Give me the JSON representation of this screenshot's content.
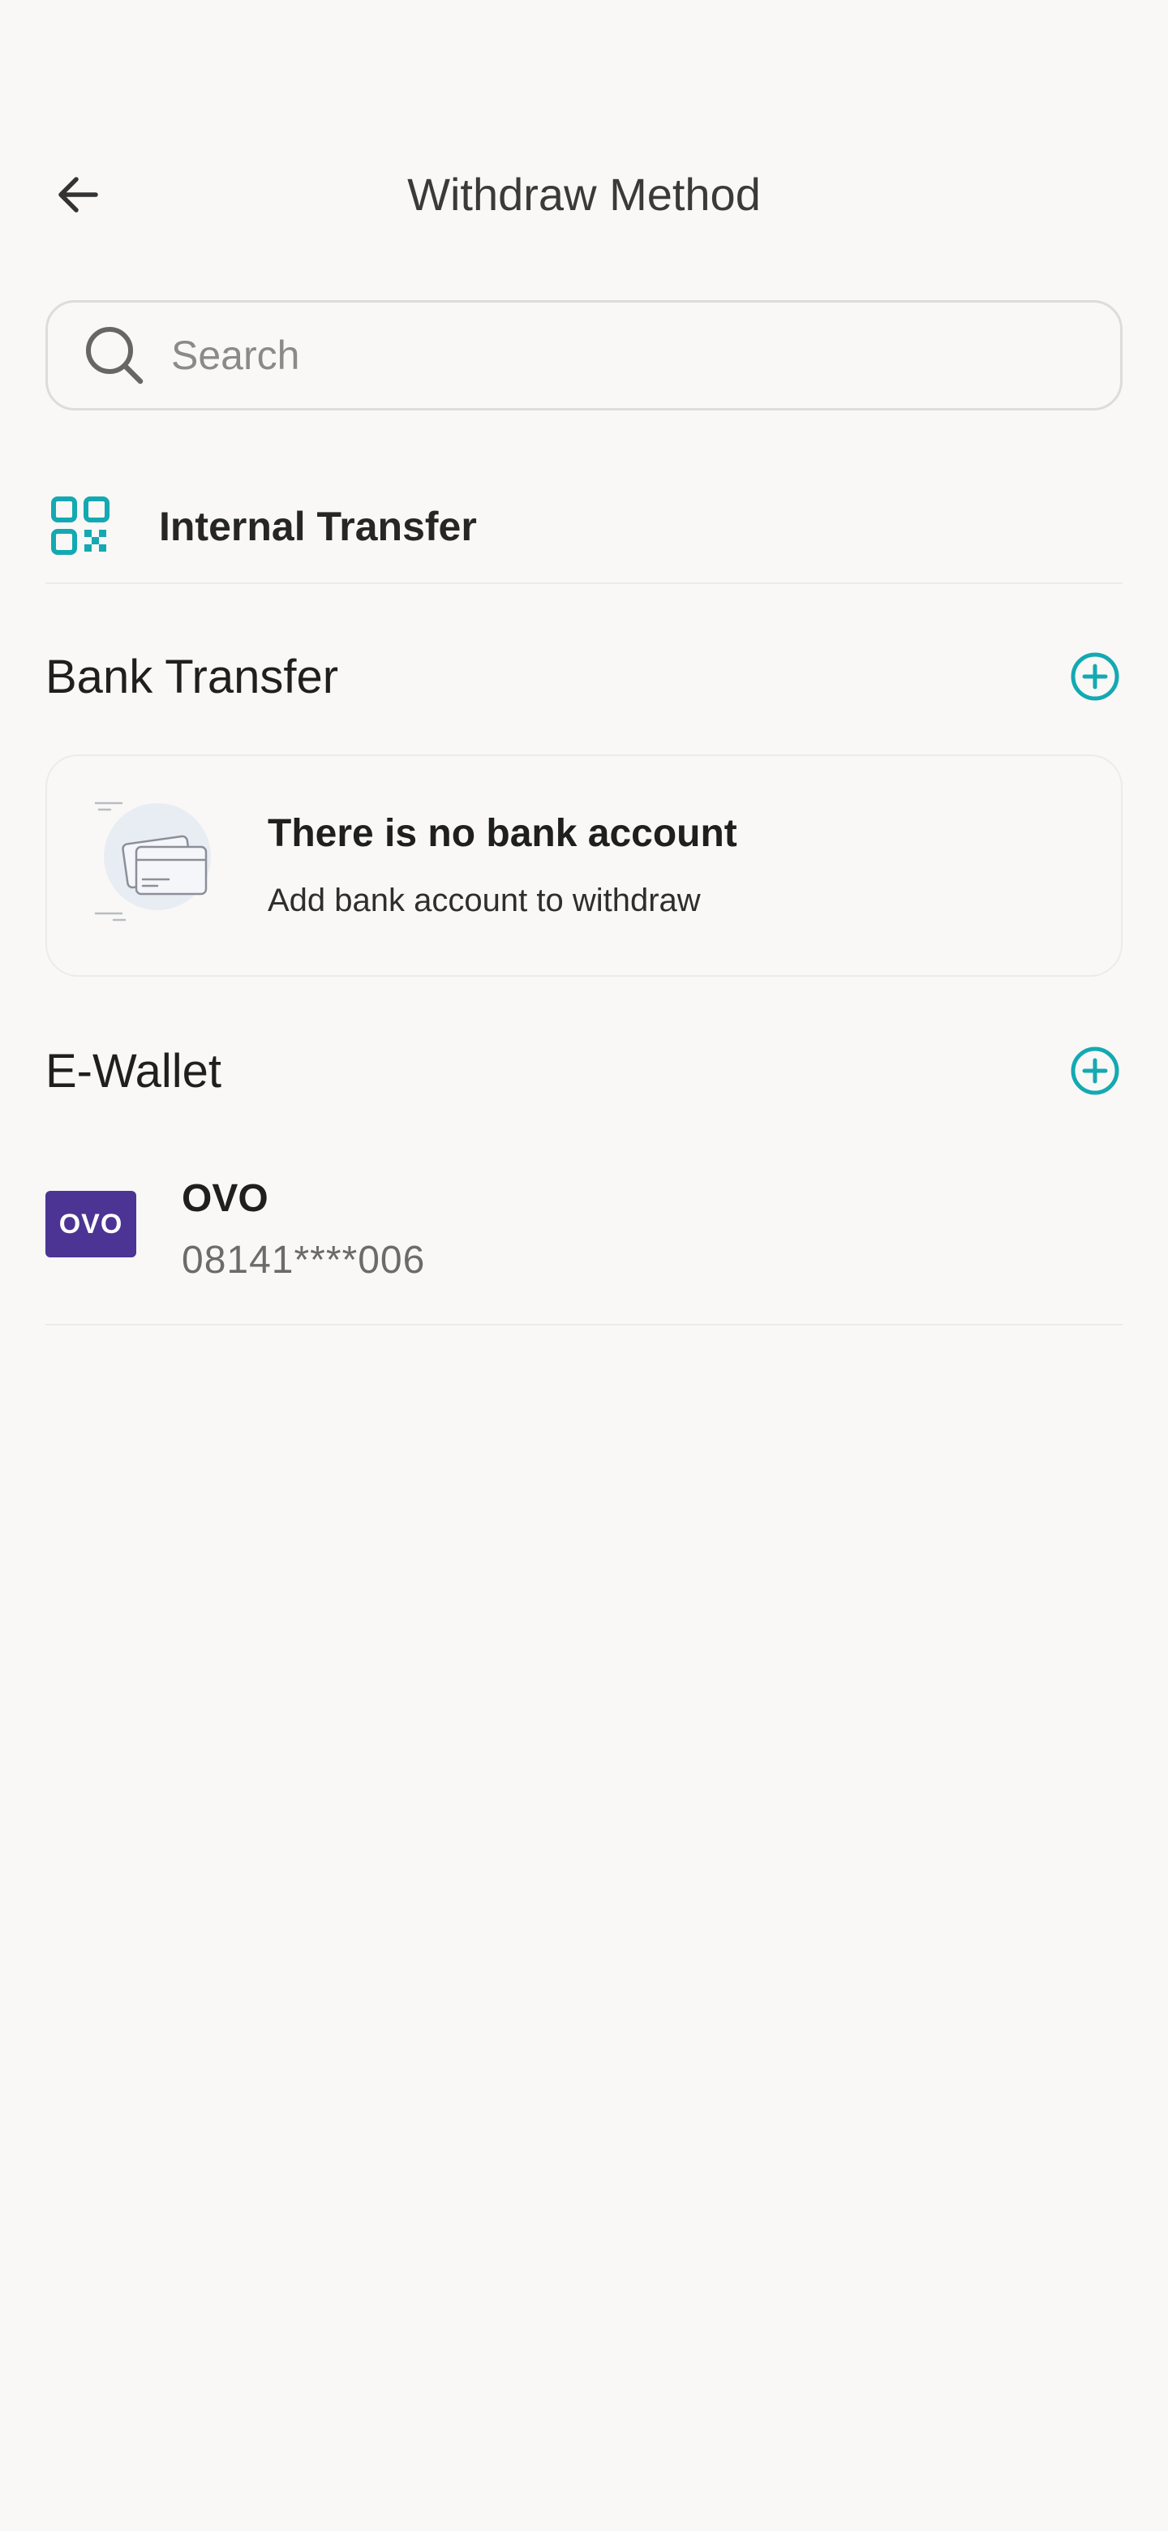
{
  "header": {
    "title": "Withdraw Method",
    "back_icon": "arrow-left-icon"
  },
  "search": {
    "placeholder": "Search",
    "value": "",
    "icon": "search-icon"
  },
  "internal_transfer": {
    "label": "Internal Transfer",
    "icon": "qr-code-icon"
  },
  "bank_transfer": {
    "title": "Bank Transfer",
    "add_icon": "plus-circle-icon",
    "empty_state": {
      "title": "There is no bank account",
      "subtitle": "Add bank account to withdraw",
      "illustration": "bank-card-illustration"
    }
  },
  "e_wallet": {
    "title": "E-Wallet",
    "add_icon": "plus-circle-icon",
    "items": [
      {
        "logo_text": "OVO",
        "name": "OVO",
        "number": "08141****006"
      }
    ]
  },
  "colors": {
    "background": "#f9f8f6",
    "accent": "#14a9b2",
    "ovo_brand": "#4c3494",
    "divider": "#ecebe8"
  }
}
